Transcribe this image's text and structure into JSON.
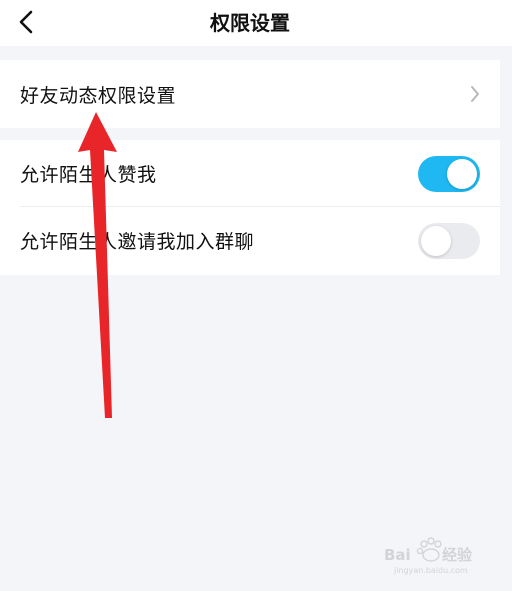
{
  "nav": {
    "title": "权限设置",
    "back_icon": "chevron-left-icon"
  },
  "group1": {
    "rows": [
      {
        "label": "好友动态权限设置",
        "icon": "chevron-right-icon"
      }
    ]
  },
  "group2": {
    "rows": [
      {
        "label": "允许陌生人赞我",
        "toggle": "on"
      },
      {
        "label": "允许陌生人邀请我加入群聊",
        "toggle": "off"
      }
    ]
  },
  "colors": {
    "background": "#f4f5f9",
    "toggle_on": "#1fb8f2",
    "toggle_off": "#eaebef",
    "annotation_arrow": "#e8262a"
  },
  "watermark": {
    "text": "Baidu经验",
    "subtext": "jingyan.baidu.com"
  }
}
